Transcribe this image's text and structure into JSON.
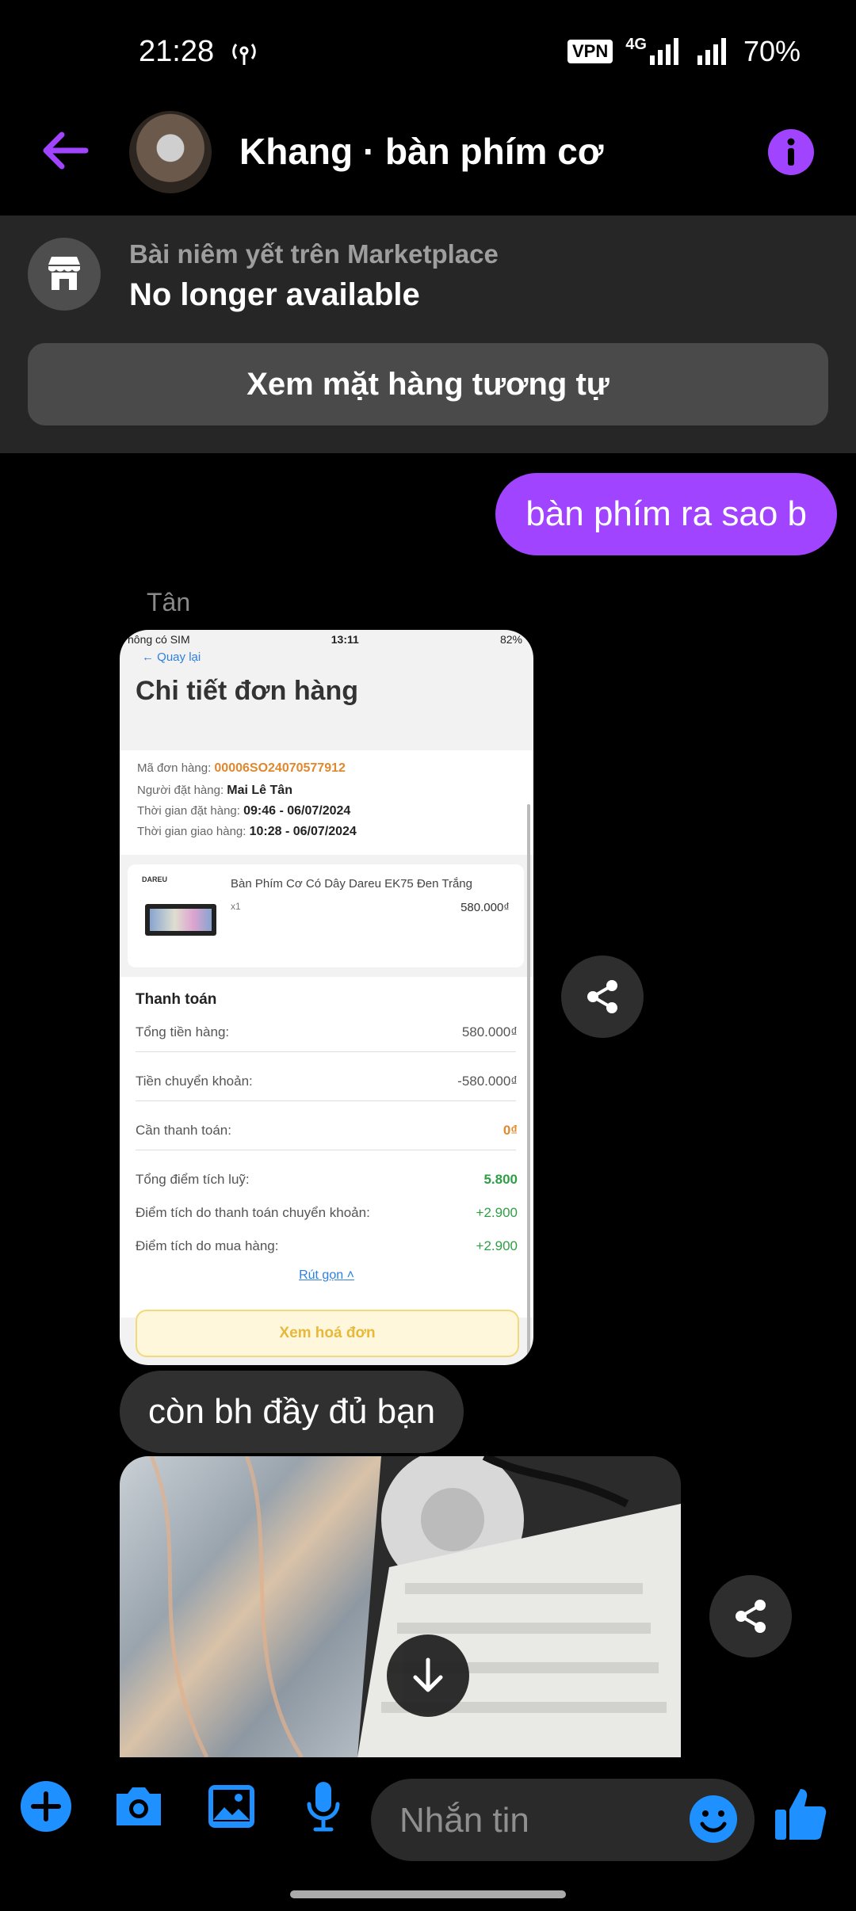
{
  "status": {
    "time": "21:28",
    "vpn": "VPN",
    "network": "4G",
    "battery": "70%"
  },
  "header": {
    "title": "Khang · bàn phím cơ"
  },
  "banner": {
    "subtitle": "Bài niêm yết trên Marketplace",
    "status": "No longer available",
    "button": "Xem mặt hàng tương tự"
  },
  "messages": {
    "outgoing": "bàn phím ra sao b",
    "sender": "Tân",
    "incoming": "còn bh đầy đủ bạn"
  },
  "order": {
    "sim": "hông có SIM",
    "time": "13:11",
    "battery": "82%",
    "back": "Quay lại",
    "title": "Chi tiết đơn hàng",
    "code_label": "Mã đơn hàng:",
    "code": "00006SO24070577912",
    "buyer_label": "Người đặt hàng:",
    "buyer": "Mai Lê Tân",
    "order_time_label": "Thời gian đặt hàng:",
    "order_time": "09:46 - 06/07/2024",
    "delivery_time_label": "Thời gian giao hàng:",
    "delivery_time": "10:28 - 06/07/2024",
    "brand": "DAREU",
    "product_name": "Bàn Phím Cơ Có Dây Dareu EK75 Đen Trắng",
    "product_qty": "x1",
    "product_price": "580.000₫",
    "payment_title": "Thanh toán",
    "total_label": "Tổng tiền hàng:",
    "total": "580.000₫",
    "transfer_label": "Tiền chuyển khoản:",
    "transfer": "-580.000₫",
    "due_label": "Cần thanh toán:",
    "due": "0₫",
    "points_label": "Tổng điểm tích luỹ:",
    "points": "5.800",
    "points_transfer_label": "Điểm tích do thanh toán chuyển khoản:",
    "points_transfer": "+2.900",
    "points_purchase_label": "Điểm tích do mua hàng:",
    "points_purchase": "+2.900",
    "collapse": "Rút gọn",
    "invoice": "Xem hoá đơn"
  },
  "composer": {
    "placeholder": "Nhắn tin"
  },
  "colors": {
    "accent": "#a044ff",
    "like": "#1e90ff",
    "order_orange": "#e0882d",
    "points_green": "#2e9e44"
  }
}
